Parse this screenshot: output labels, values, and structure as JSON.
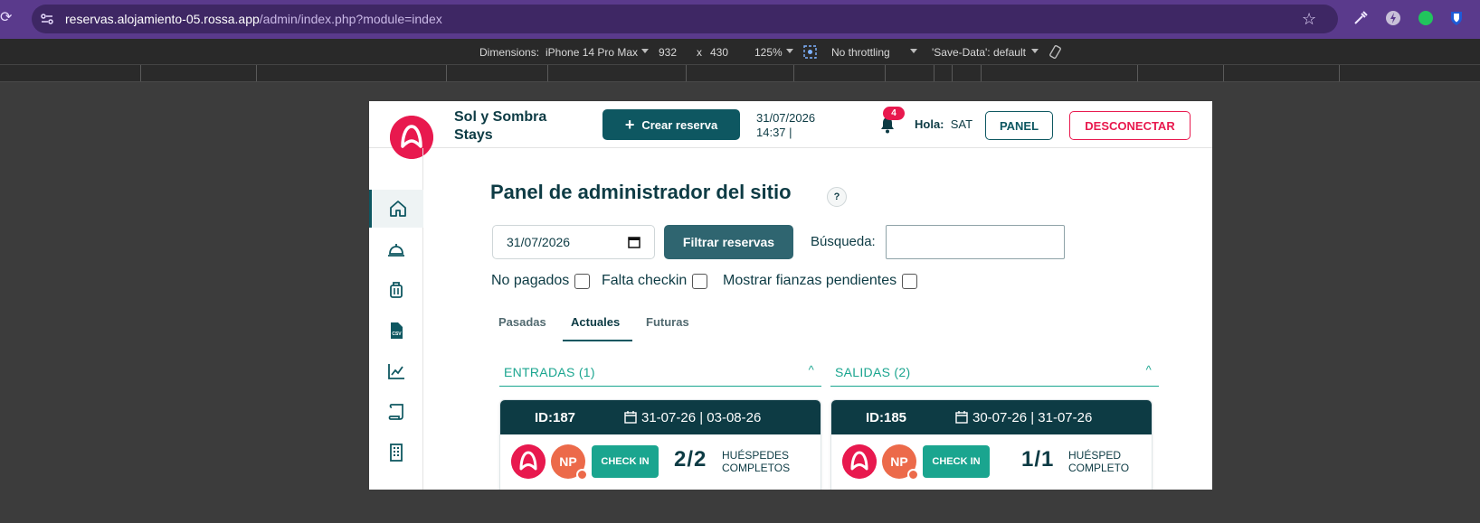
{
  "browser": {
    "url_host": "reservas.alojamiento-05.rossa.app",
    "url_path": "/admin/index.php?module=index"
  },
  "devtools": {
    "dimensions_label": "Dimensions:",
    "device": "iPhone 14 Pro Max",
    "width": "932",
    "times": "x",
    "height": "430",
    "zoom": "125%",
    "throttling": "No throttling",
    "save_data": "'Save-Data': default"
  },
  "header": {
    "hotel_name": "Sol y Sombra Stays",
    "create_button": "Crear reserva",
    "date": "31/07/2026",
    "time": "14:37 |",
    "notifications_count": "4",
    "greeting_label": "Hola:",
    "user": "SAT",
    "panel_button": "PANEL",
    "logout_button": "DESCONECTAR"
  },
  "sidebar": {
    "items": [
      {
        "icon": "home-icon",
        "active": true
      },
      {
        "icon": "reception-bell-icon",
        "active": false
      },
      {
        "icon": "luggage-icon",
        "active": false
      },
      {
        "icon": "csv-file-icon",
        "active": false
      },
      {
        "icon": "chart-line-icon",
        "active": false
      },
      {
        "icon": "scroll-icon",
        "active": false
      },
      {
        "icon": "building-icon",
        "active": false
      }
    ]
  },
  "main": {
    "title": "Panel de administrador del sitio",
    "help": "?",
    "date_value": "31/07/2026",
    "filter_button": "Filtrar reservas",
    "search_label": "Búsqueda:",
    "search_value": "",
    "checkboxes": [
      {
        "label": "No pagados",
        "checked": false
      },
      {
        "label": "Falta checkin",
        "checked": false
      },
      {
        "label": "Mostrar fianzas pendientes",
        "checked": false
      }
    ],
    "tabs": [
      {
        "label": "Pasadas",
        "active": false
      },
      {
        "label": "Actuales",
        "active": true
      },
      {
        "label": "Futuras",
        "active": false
      }
    ]
  },
  "sections": {
    "entries": {
      "title": "ENTRADAS (1)",
      "card": {
        "id": "ID:187",
        "dates": "31-07-26 | 03-08-26",
        "np": "NP",
        "action": "CHECK IN",
        "guests": "2/2",
        "guests_label": "HUÉSPEDES COMPLETOS"
      }
    },
    "exits": {
      "title": "SALIDAS (2)",
      "card": {
        "id": "ID:185",
        "dates": "30-07-26 | 31-07-26",
        "np": "NP",
        "action": "CHECK IN",
        "guests": "1/1",
        "guests_label": "HUÉSPED COMPLETO"
      }
    }
  },
  "colors": {
    "brand_red": "#e8194e",
    "brand_teal": "#0e5761",
    "accent_green": "#1aa58f",
    "dark_text": "#0d3b44"
  }
}
